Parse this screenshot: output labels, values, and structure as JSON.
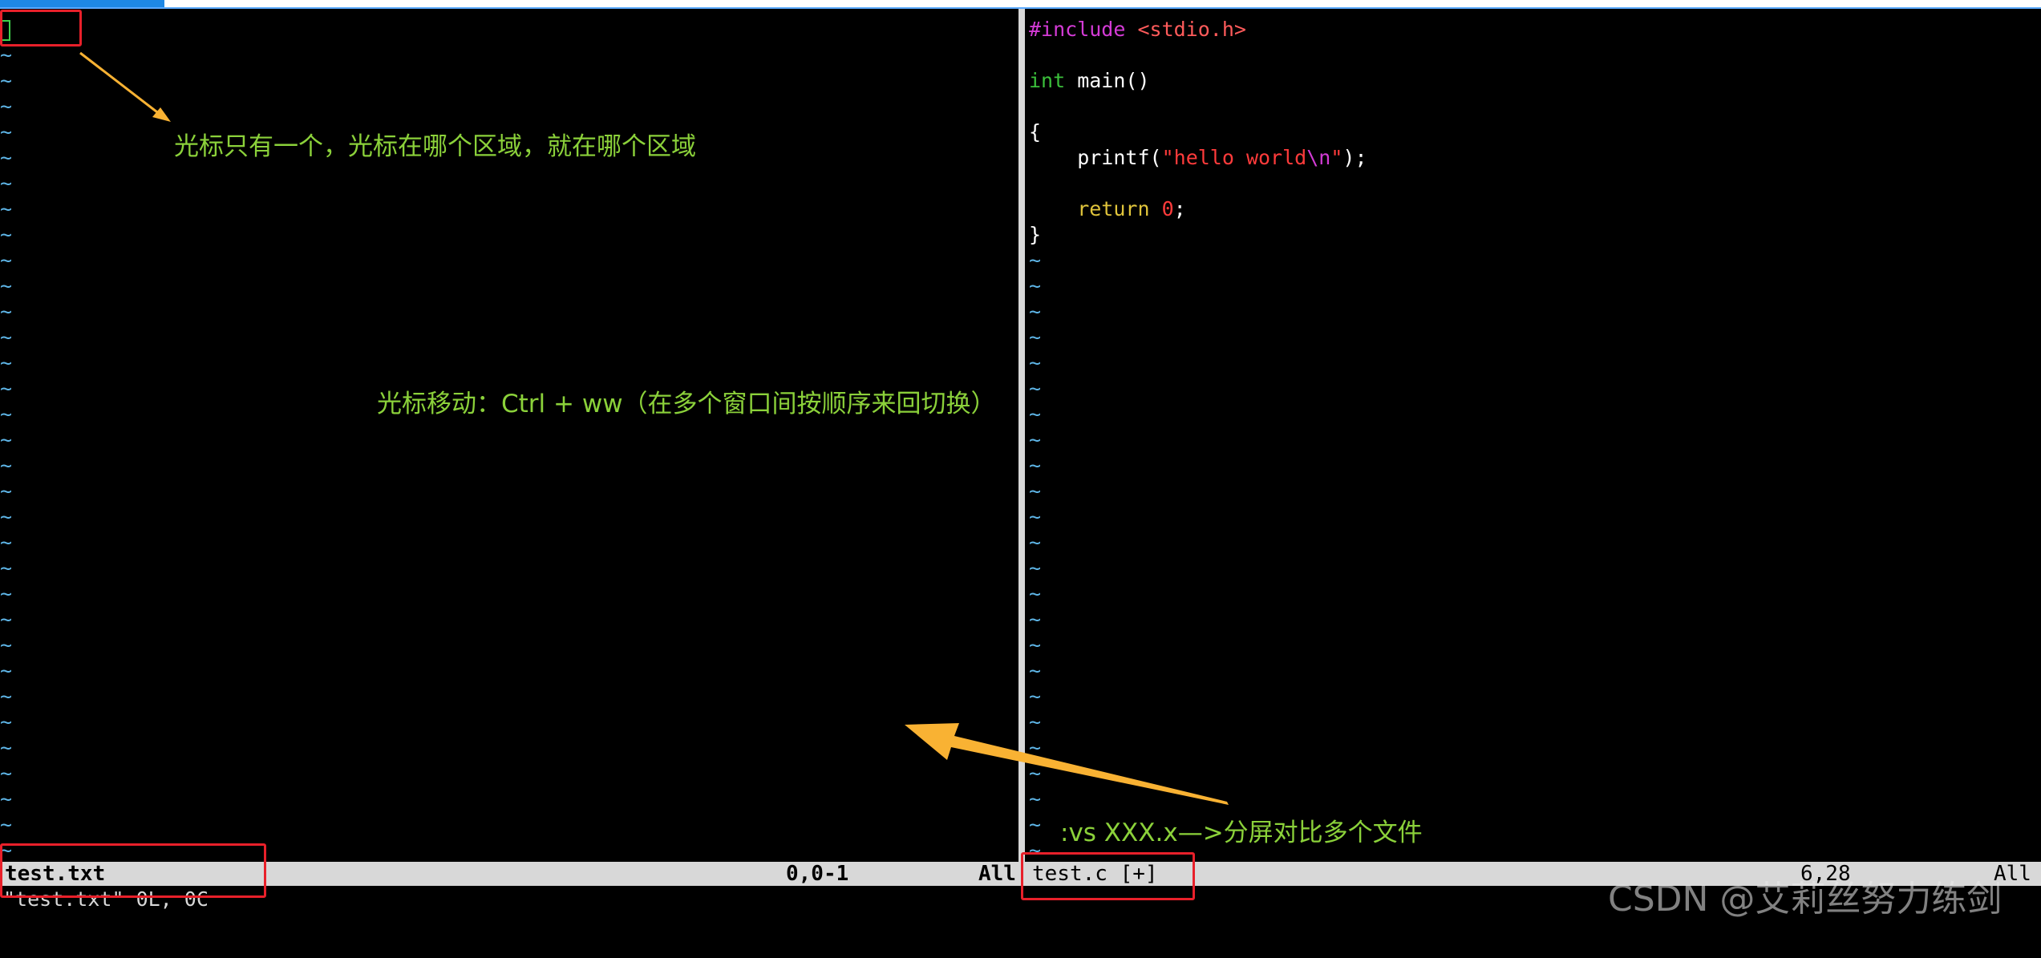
{
  "left": {
    "tilde": "~",
    "status": {
      "filename": "test.txt",
      "position": "0,0-1",
      "scroll": "All"
    },
    "message": "\"test.txt\" 0L, 0C"
  },
  "right": {
    "code": {
      "include_kw": "#include",
      "include_file": " <stdio.h>",
      "int_kw": "int",
      "main_sig": " main()",
      "open_brace": "{",
      "printf_fn": "    printf(",
      "str_open": "\"",
      "str_text": "hello world",
      "str_esc": "\\n",
      "str_close": "\"",
      "printf_end": ");",
      "return_kw": "    return",
      "return_space": " ",
      "return_val": "0",
      "return_end": ";",
      "close_brace": "}"
    },
    "tilde": "~",
    "status": {
      "filename": "test.c [+]",
      "position": "6,28",
      "scroll": "All"
    }
  },
  "annotations": {
    "cursor_note": "光标只有一个，光标在哪个区域，就在哪个区域",
    "move_note": "光标移动：Ctrl + ww（在多个窗口间按顺序来回切换）",
    "split_note": ":vs XXX.x—>分屏对比多个文件"
  },
  "watermark": "CSDN @艾莉丝努力练剑",
  "colors": {
    "annotation": "#8bd13a",
    "box": "#e8202a",
    "arrow": "#f9b233",
    "tilde": "#5fb7e9"
  }
}
